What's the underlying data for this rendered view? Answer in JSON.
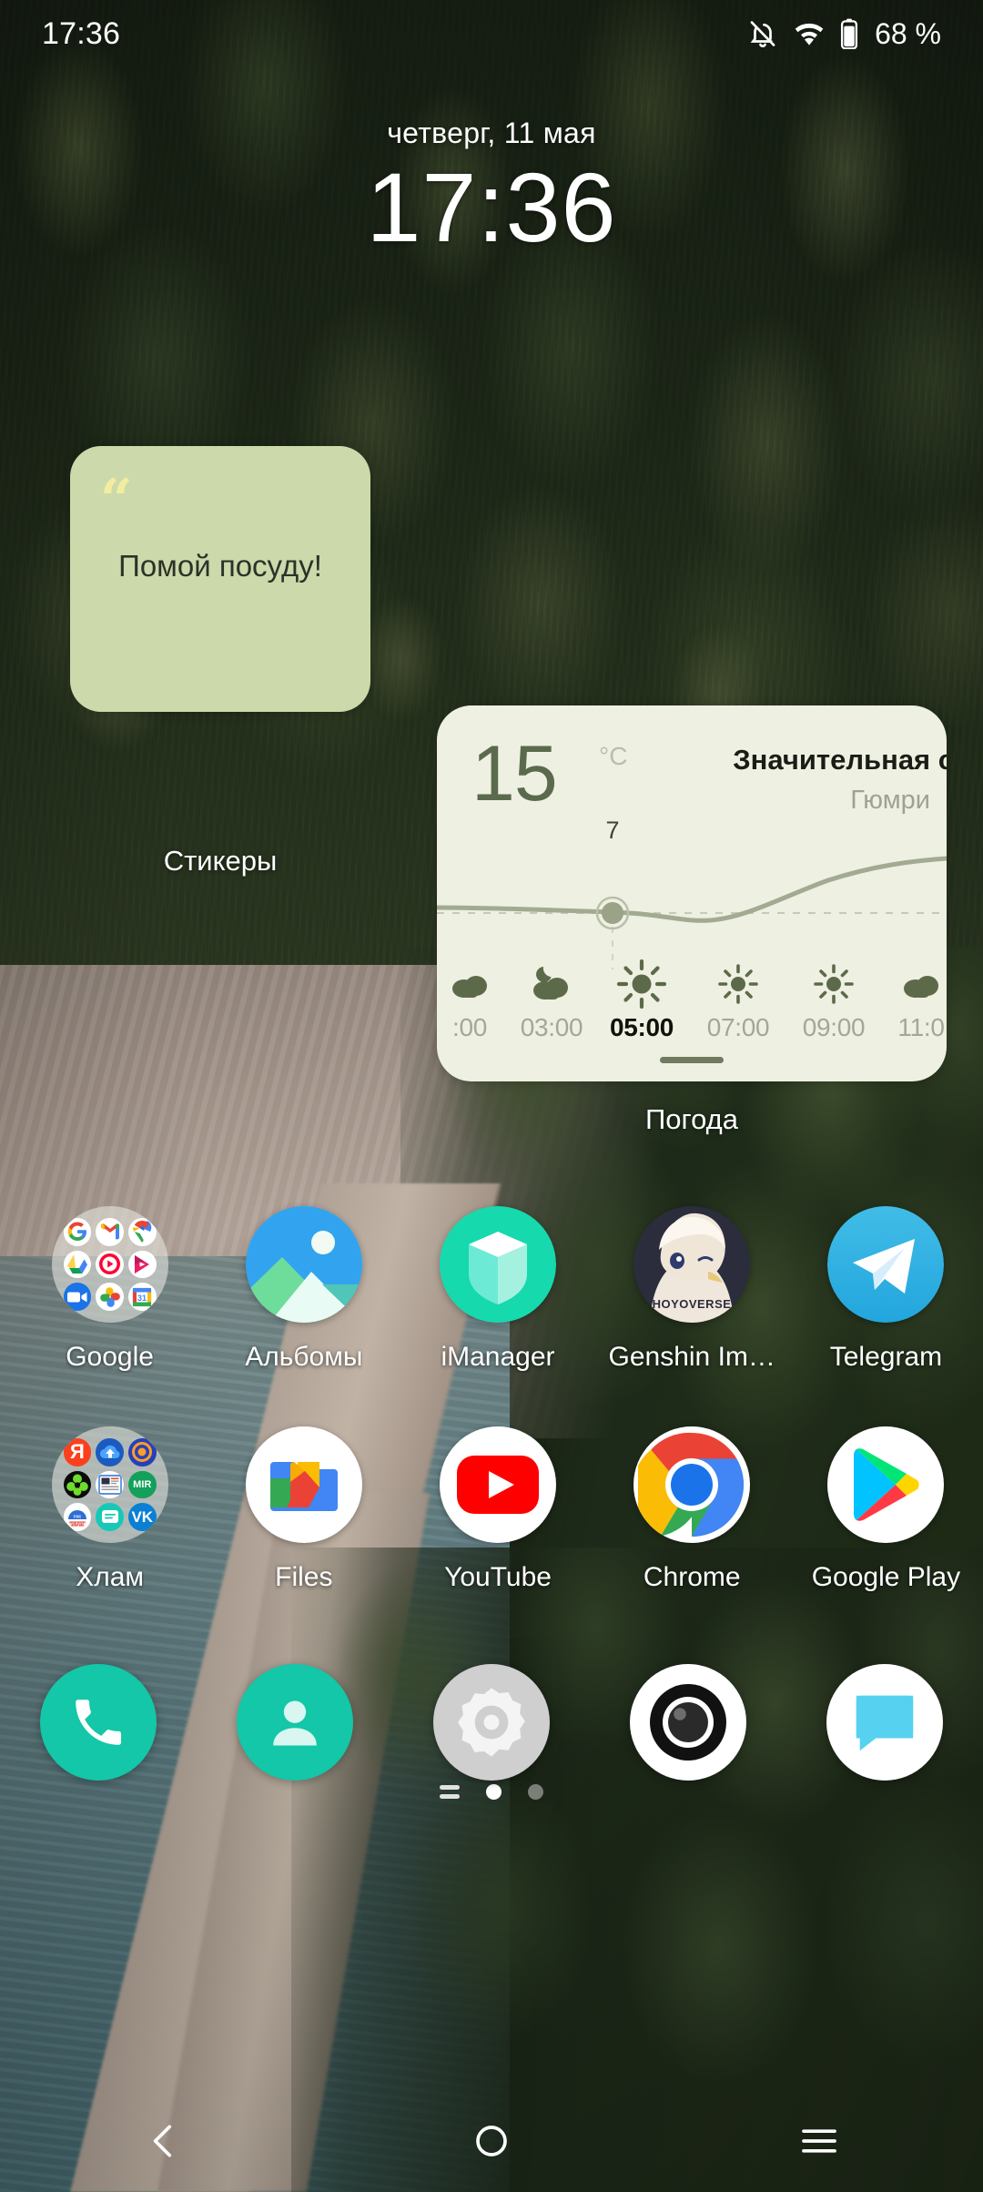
{
  "statusbar": {
    "time": "17:36",
    "battery_percent": "68 %",
    "icons": [
      "bell-muted-icon",
      "wifi-icon",
      "battery-icon"
    ]
  },
  "clock_widget": {
    "date": "четверг, 11 мая",
    "time": "17:36"
  },
  "sticker_widget": {
    "quote_mark": "“",
    "text": "Помой посуду!",
    "label": "Стикеры",
    "background_color": "#ccd9ab",
    "quote_color": "#f2eda0",
    "text_color": "#2c3228"
  },
  "weather_widget": {
    "temperature": "15",
    "unit": "°C",
    "condition": "Значительная с",
    "city": "Гюмри",
    "label": "Погода",
    "background_color": "#eef0e2",
    "temp_color": "#5b6a4d",
    "accent_color": "#6f7a5f",
    "selected_point_value": "7",
    "hours": [
      {
        "time": ":00",
        "icon": "cloud-icon",
        "active": false,
        "clipped": true
      },
      {
        "time": "03:00",
        "icon": "moon-cloud-icon",
        "active": false,
        "clipped": false
      },
      {
        "time": "05:00",
        "icon": "sun-icon",
        "active": true,
        "clipped": false
      },
      {
        "time": "07:00",
        "icon": "sun-small-icon",
        "active": false,
        "clipped": false
      },
      {
        "time": "09:00",
        "icon": "sun-small-icon",
        "active": false,
        "clipped": false
      },
      {
        "time": "11:0",
        "icon": "cloud-icon",
        "active": false,
        "clipped": true
      }
    ]
  },
  "app_grid": {
    "rows": [
      [
        {
          "label": "Google",
          "icon": "google-folder-icon",
          "type": "folder"
        },
        {
          "label": "Альбомы",
          "icon": "gallery-icon",
          "type": "app"
        },
        {
          "label": "iManager",
          "icon": "imanager-icon",
          "type": "app"
        },
        {
          "label": "Genshin Im…",
          "icon": "genshin-impact-icon",
          "type": "app"
        },
        {
          "label": "Telegram",
          "icon": "telegram-icon",
          "type": "app"
        }
      ],
      [
        {
          "label": "Хлам",
          "icon": "junk-folder-icon",
          "type": "folder"
        },
        {
          "label": "Files",
          "icon": "files-icon",
          "type": "app"
        },
        {
          "label": "YouTube",
          "icon": "youtube-icon",
          "type": "app"
        },
        {
          "label": "Chrome",
          "icon": "chrome-icon",
          "type": "app"
        },
        {
          "label": "Google Play",
          "icon": "google-play-icon",
          "type": "app"
        }
      ]
    ]
  },
  "page_indicator": {
    "pages": 2,
    "active_page": 1,
    "has_menu_glyph": true
  },
  "dock": {
    "items": [
      {
        "name": "phone",
        "icon": "phone-icon"
      },
      {
        "name": "contacts",
        "icon": "contacts-icon"
      },
      {
        "name": "settings",
        "icon": "settings-gear-icon"
      },
      {
        "name": "camera",
        "icon": "camera-icon"
      },
      {
        "name": "messages",
        "icon": "messages-icon"
      }
    ]
  },
  "navbar": {
    "items": [
      {
        "name": "back",
        "icon": "back-chevron-icon"
      },
      {
        "name": "home",
        "icon": "home-circle-icon"
      },
      {
        "name": "recent",
        "icon": "recents-lines-icon"
      }
    ]
  }
}
